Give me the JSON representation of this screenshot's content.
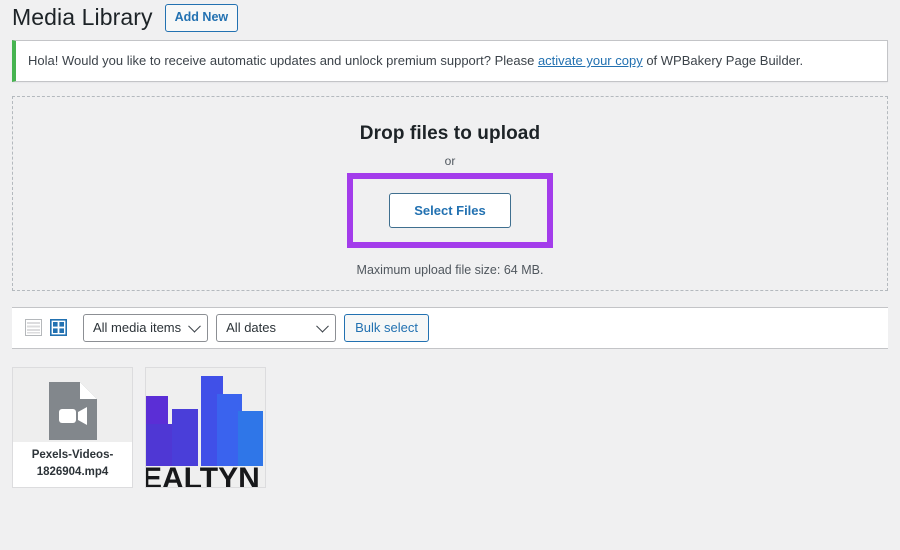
{
  "header": {
    "title": "Media Library",
    "add_new_label": "Add New"
  },
  "notice": {
    "text_before": "Hola! Would you like to receive automatic updates and unlock premium support? Please ",
    "link_label": "activate your copy",
    "text_after": " of WPBakery Page Builder.",
    "accent_color": "#46b450"
  },
  "uploader": {
    "drop_title": "Drop files to upload",
    "or_label": "or",
    "select_files_label": "Select Files",
    "max_size_note": "Maximum upload file size: 64 MB.",
    "highlight_color": "#a33ceb"
  },
  "toolbar": {
    "list_view_icon": "list-view-icon",
    "grid_view_icon": "grid-view-icon",
    "media_filter_value": "All media items",
    "date_filter_value": "All dates",
    "bulk_select_label": "Bulk select"
  },
  "media_items": [
    {
      "type": "video",
      "icon": "video-file-icon",
      "filename": "Pexels-Videos-1826904.mp4"
    },
    {
      "type": "image",
      "icon": "logo-thumbnail",
      "logo_text": "EALTYN",
      "colors": [
        "#5b2ed6",
        "#4f37d4",
        "#4050e8",
        "#3a63ee",
        "#2f76e8"
      ]
    }
  ]
}
